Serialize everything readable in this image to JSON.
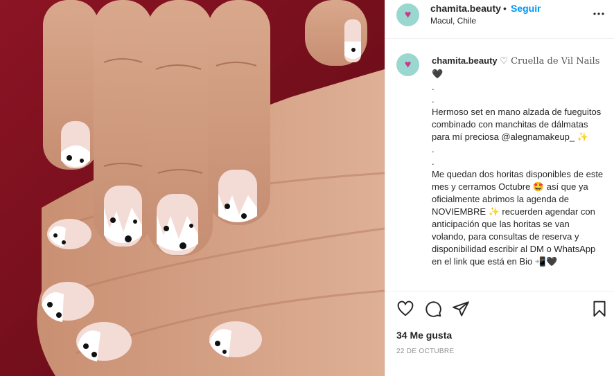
{
  "post": {
    "username": "chamita.beauty",
    "separator": "•",
    "follow_label": "Seguir",
    "location": "Macul, Chile",
    "avatar_icon": "heart-avatar-icon",
    "accent_color": "#0095f6",
    "caption": {
      "username": "chamita.beauty",
      "title": "♡ Cruella de Vil Nails🖤",
      "body": ".\n.\nHermoso set en mano alzada de fueguitos combinado con manchitas de dálmatas para mí preciosa @alegnamakeup_ ✨\n.\n.\nMe quedan dos horitas disponibles de este mes y cerramos Octubre 🤩 así que ya oficialmente abrimos la agenda de NOVIEMBRE ✨ recuerden agendar con anticipación que las horitas se van volando, para consultas de reserva y disponibilidad escribir al DM o WhatsApp en el link que está en Bio 📲🖤"
    },
    "likes_label": "34 Me gusta",
    "date_label": "22 DE OCTUBRE"
  },
  "icons": {
    "more": "more-options-icon",
    "like": "heart-icon",
    "comment": "comment-icon",
    "share": "paper-plane-icon",
    "save": "bookmark-icon"
  }
}
